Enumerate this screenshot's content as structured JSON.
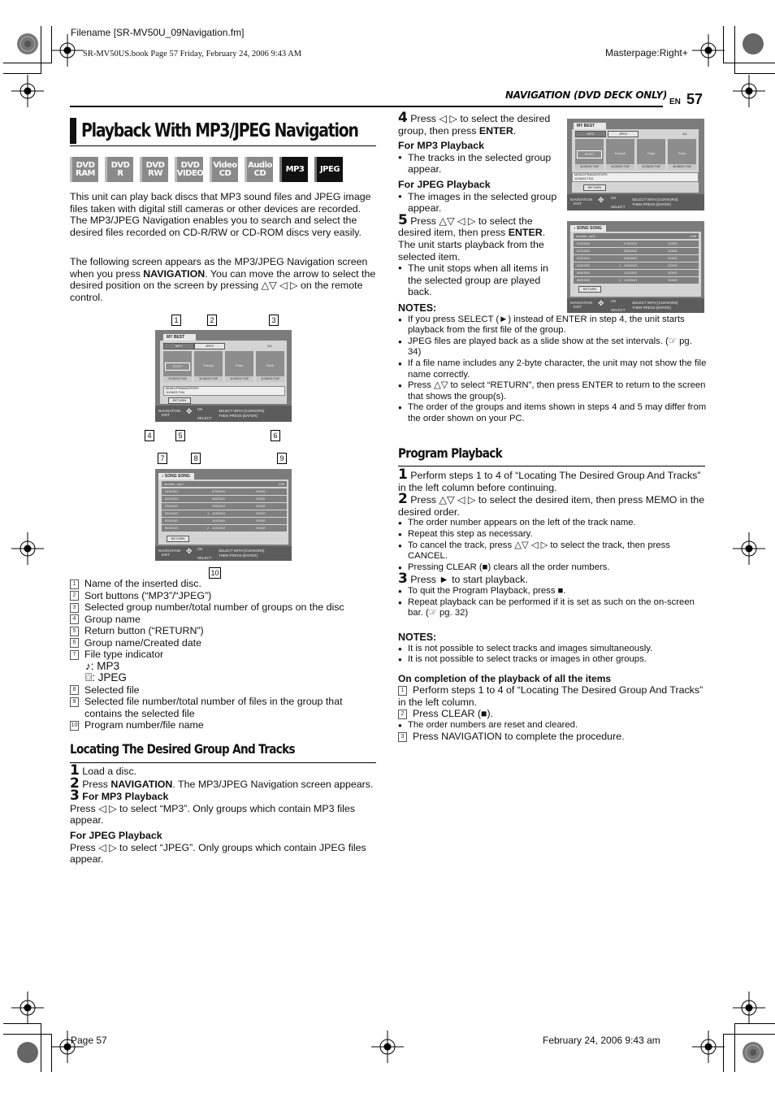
{
  "print_marks": {
    "filename": "Filename [SR-MV50U_09Navigation.fm]",
    "book_info": "SR-MV50US.book  Page 57  Friday, February 24, 2006  9:43 AM",
    "masterpage": "Masterpage:Right+",
    "footer_page": "Page 57",
    "footer_date": "February 24, 2006 9:43 am"
  },
  "header": {
    "section": "NAVIGATION (DVD DECK ONLY)",
    "lang": "EN",
    "page_number": "57"
  },
  "title": "Playback With MP3/JPEG Navigation",
  "disc_badges": [
    {
      "line1": "DVD",
      "line2": "RAM",
      "active": false
    },
    {
      "line1": "DVD",
      "line2": "R",
      "active": false
    },
    {
      "line1": "DVD",
      "line2": "RW",
      "active": false
    },
    {
      "line1": "DVD",
      "line2": "VIDEO",
      "active": false
    },
    {
      "line1": "Video",
      "line2": "CD",
      "active": false
    },
    {
      "line1": "Audio",
      "line2": "CD",
      "active": false
    },
    {
      "line1": "MP3",
      "line2": "",
      "active": true
    },
    {
      "line1": "JPEG",
      "line2": "",
      "active": true
    }
  ],
  "intro": {
    "p1": "This unit can play back discs that MP3 sound files and JPEG image files taken with digital still cameras or other devices are recorded.",
    "p2": "The MP3/JPEG Navigation enables you to search and select the desired files recorded on CD-R/RW or CD-ROM discs very easily.",
    "p3_a": "The following screen appears as the MP3/JPEG Navigation screen when you press ",
    "p3_bold": "NAVIGATION",
    "p3_b": ". You can move the arrow to select the desired position on the screen by pressing △▽ ◁ ▷ on the remote control."
  },
  "screen1": {
    "disc_name": "MY BEST",
    "sort_buttons": [
      "MP3",
      "JPEG"
    ],
    "group_count": "1/1",
    "groups": [
      {
        "name": "ROOT",
        "date": "11/26/03 TUE"
      },
      {
        "name": "Europe",
        "date": "11/26/03 TUE"
      },
      {
        "name": "Pops",
        "date": "11/26/03 TUE"
      },
      {
        "name": "Rock",
        "date": "11/26/03 TUE"
      }
    ],
    "info_line1": "MUSIC/FRANCE/POPS",
    "info_line2": "11/26/03 THU",
    "return_label": "RETURN",
    "nav_left1": "NAVIGATION",
    "nav_left2": "EXIT",
    "nav_ok": "OK",
    "nav_select": "SELECT",
    "nav_right1": "SELECT WITH [CURSORS]",
    "nav_right2": "THEN PRESS [ENTER]",
    "callouts": [
      "1",
      "2",
      "3",
      "4",
      "5",
      "6"
    ]
  },
  "screen2": {
    "group_title": "♪ SONG SONG",
    "file_name": "another_mp3",
    "file_count": "1/48",
    "col1": [
      "01SONG",
      "02SONG",
      "03SONG",
      "04SONG",
      "05SONG",
      "06SONG"
    ],
    "col_prog": [
      "",
      "",
      "",
      "1",
      "",
      "2"
    ],
    "col2": [
      "07SONG",
      "08SONG",
      "09SONG",
      "10SONG",
      "11SONG",
      "12SONG"
    ],
    "col3": [
      "SONG",
      "SONG",
      "SONG",
      "SONG",
      "SONG",
      "SONG"
    ],
    "return_label": "RETURN",
    "callouts": [
      "7",
      "8",
      "9",
      "10"
    ]
  },
  "legend": [
    {
      "num": "1",
      "text": "Name of the inserted disc."
    },
    {
      "num": "2",
      "text": "Sort buttons (“MP3”/“JPEG”)"
    },
    {
      "num": "3",
      "text": "Selected group number/total number of groups on the disc"
    },
    {
      "num": "4",
      "text": "Group name"
    },
    {
      "num": "5",
      "text": "Return button (“RETURN”)"
    },
    {
      "num": "6",
      "text": "Group name/Created date"
    },
    {
      "num": "7",
      "text": "File type indicator"
    },
    {
      "num": "",
      "text": "♪:   MP3"
    },
    {
      "num": "",
      "text": "⌼:  JPEG"
    },
    {
      "num": "8",
      "text": "Selected file"
    },
    {
      "num": "9",
      "text": "Selected file number/total number of files in the group that contains the selected file"
    },
    {
      "num": "10",
      "text": "Program number/file name"
    }
  ],
  "locating": {
    "heading": "Locating The Desired Group And Tracks",
    "s1": "Load a disc.",
    "s2_a": "Press ",
    "s2_bold": "NAVIGATION",
    "s2_b": ". The MP3/JPEG Navigation screen appears.",
    "s3_mp3_head": "For MP3 Playback",
    "s3_mp3_text": "Press ◁ ▷ to select “MP3”. Only groups which contain MP3 files appear.",
    "s3_jpeg_head": "For JPEG Playback",
    "s3_jpeg_text": "Press ◁ ▷ to select “JPEG”. Only groups which contain JPEG files appear.",
    "s4_a": "Press ◁ ▷ to select the desired group, then press ",
    "s4_bold": "ENTER",
    "s4_mp3_head": "For MP3 Playback",
    "s4_mp3_bullet": "The tracks in the selected group appear.",
    "s4_jpeg_head": "For JPEG Playback",
    "s4_jpeg_bullet": "The images in the selected group appear.",
    "s5_a": "Press △▽ ◁ ▷ to select the desired item, then press ",
    "s5_bold": "ENTER",
    "s5_b": ". The unit starts playback from the selected item.",
    "s5_bullet": "The unit stops when all items in the selected group are played back."
  },
  "notes1": {
    "heading": "NOTES:",
    "items": [
      "If you press SELECT (►) instead of ENTER in step 4, the unit starts playback from the first file of the group.",
      "JPEG files are played back as a slide show at the set intervals. (☞ pg. 34)",
      "If a file name includes any 2-byte character, the unit may not show the file name correctly.",
      "Press △▽ to select “RETURN”, then press ENTER to return to the screen that shows the group(s).",
      "The order of the groups and items shown in steps 4 and 5 may differ from the order shown on your PC."
    ]
  },
  "program": {
    "heading": "Program Playback",
    "s1": "Perform steps 1 to 4 of “Locating The Desired Group And Tracks” in the left column before continuing.",
    "s2": "Press △▽ ◁ ▷ to select the desired item, then press MEMO in the desired order.",
    "s2_bullets": [
      "The order number appears on the left of the track name.",
      "Repeat this step as necessary.",
      "To cancel the track, press △▽ ◁ ▷ to select the track, then press CANCEL.",
      "Pressing CLEAR (■) clears all the order numbers."
    ],
    "s3": "Press ► to start playback.",
    "s3_bullets": [
      "To quit the Program Playback, press ■.",
      "Repeat playback can be performed if it is set as such on the on-screen bar. (☞ pg. 32)"
    ]
  },
  "notes2": {
    "heading": "NOTES:",
    "items": [
      "It is not possible to select tracks and images simultaneously.",
      "It is not possible to select tracks or images in other groups."
    ]
  },
  "completion": {
    "heading": "On completion of the playback of all the items",
    "step1": "Perform steps 1 to 4 of “Locating The Desired Group And Tracks” in the left column.",
    "step2": "Press CLEAR (■).",
    "bullet": "The order numbers are reset and cleared.",
    "step3": "Press NAVIGATION to complete the procedure."
  }
}
